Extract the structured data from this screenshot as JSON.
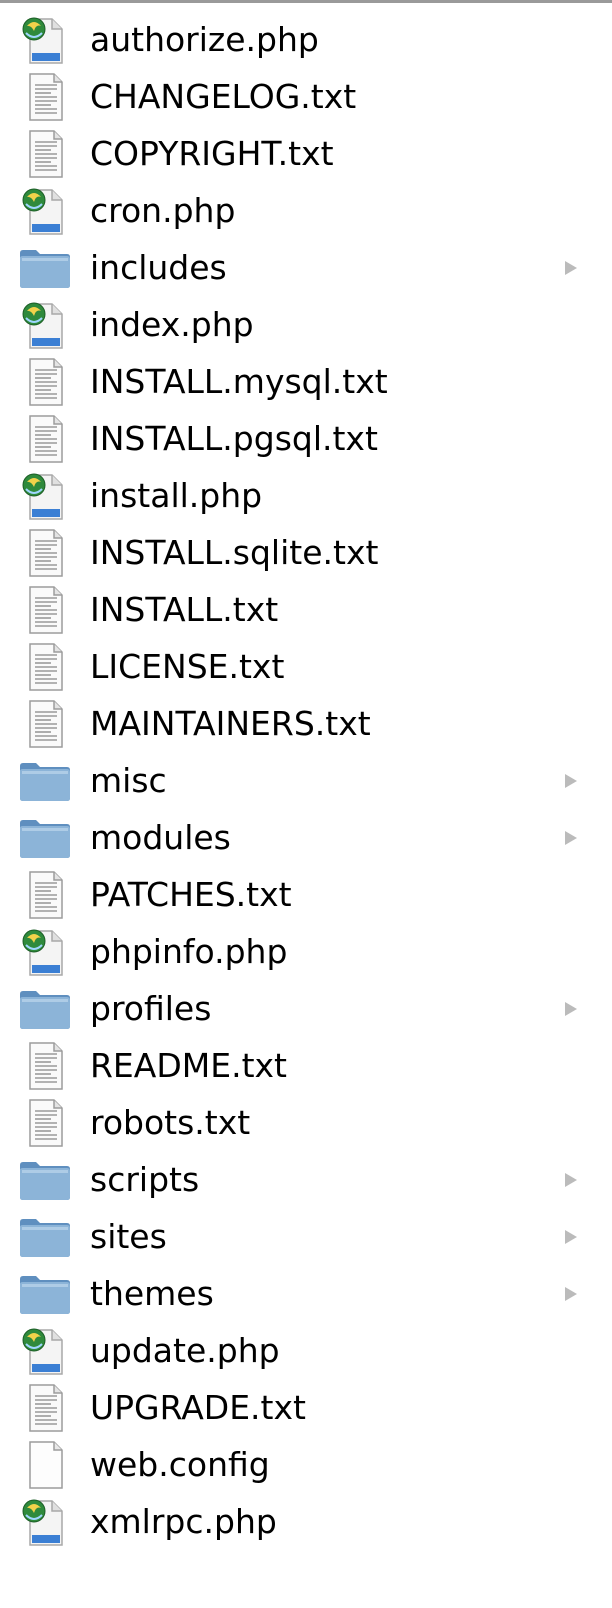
{
  "colors": {
    "folder": "#8cb4d8",
    "folder_dark": "#5f8fbf",
    "text": "#000000",
    "doc_lines": "#9a9a9a",
    "disclosure": "#bbbbbb"
  },
  "files": [
    {
      "name": "authorize.php",
      "kind": "php",
      "icon": "php-file-icon"
    },
    {
      "name": "CHANGELOG.txt",
      "kind": "text",
      "icon": "text-document-icon"
    },
    {
      "name": "COPYRIGHT.txt",
      "kind": "text",
      "icon": "text-document-icon"
    },
    {
      "name": "cron.php",
      "kind": "php",
      "icon": "php-file-icon"
    },
    {
      "name": "includes",
      "kind": "folder",
      "icon": "folder-icon"
    },
    {
      "name": "index.php",
      "kind": "php",
      "icon": "php-file-icon"
    },
    {
      "name": "INSTALL.mysql.txt",
      "kind": "text",
      "icon": "text-document-icon"
    },
    {
      "name": "INSTALL.pgsql.txt",
      "kind": "text",
      "icon": "text-document-icon"
    },
    {
      "name": "install.php",
      "kind": "php",
      "icon": "php-file-icon"
    },
    {
      "name": "INSTALL.sqlite.txt",
      "kind": "text",
      "icon": "text-document-icon"
    },
    {
      "name": "INSTALL.txt",
      "kind": "text",
      "icon": "text-document-icon"
    },
    {
      "name": "LICENSE.txt",
      "kind": "text",
      "icon": "text-document-icon"
    },
    {
      "name": "MAINTAINERS.txt",
      "kind": "text",
      "icon": "text-document-icon"
    },
    {
      "name": "misc",
      "kind": "folder",
      "icon": "folder-icon"
    },
    {
      "name": "modules",
      "kind": "folder",
      "icon": "folder-icon"
    },
    {
      "name": "PATCHES.txt",
      "kind": "text",
      "icon": "text-document-icon"
    },
    {
      "name": "phpinfo.php",
      "kind": "php",
      "icon": "php-file-icon"
    },
    {
      "name": "profiles",
      "kind": "folder",
      "icon": "folder-icon"
    },
    {
      "name": "README.txt",
      "kind": "text",
      "icon": "text-document-icon"
    },
    {
      "name": "robots.txt",
      "kind": "text",
      "icon": "text-document-icon"
    },
    {
      "name": "scripts",
      "kind": "folder",
      "icon": "folder-icon"
    },
    {
      "name": "sites",
      "kind": "folder",
      "icon": "folder-icon"
    },
    {
      "name": "themes",
      "kind": "folder",
      "icon": "folder-icon"
    },
    {
      "name": "update.php",
      "kind": "php",
      "icon": "php-file-icon"
    },
    {
      "name": "UPGRADE.txt",
      "kind": "text",
      "icon": "text-document-icon"
    },
    {
      "name": "web.config",
      "kind": "blank",
      "icon": "blank-document-icon"
    },
    {
      "name": "xmlrpc.php",
      "kind": "php",
      "icon": "php-file-icon"
    }
  ]
}
